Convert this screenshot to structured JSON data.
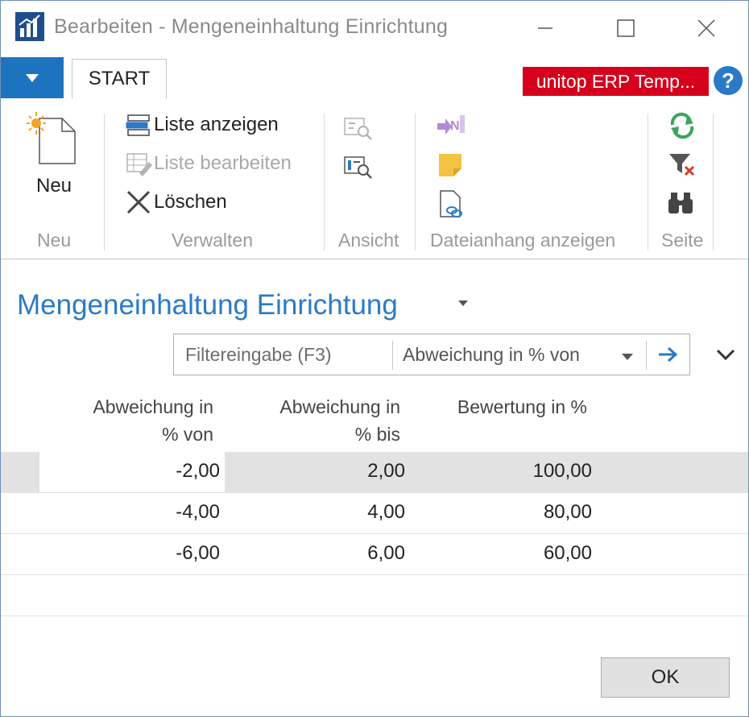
{
  "window": {
    "title": "Bearbeiten - Mengeneinhaltung Einrichtung"
  },
  "ribbon": {
    "tab_start": "START",
    "company": "unitop ERP Temp...",
    "help": "?",
    "groups": {
      "neu": {
        "label": "Neu",
        "new_button": "Neu"
      },
      "verwalten": {
        "label": "Verwalten",
        "show_list": "Liste anzeigen",
        "edit_list": "Liste bearbeiten",
        "delete": "Löschen"
      },
      "ansicht": {
        "label": "Ansicht"
      },
      "dateianhang": {
        "label": "Dateianhang anzeigen"
      },
      "seite": {
        "label": "Seite"
      }
    }
  },
  "page": {
    "title": "Mengeneinhaltung Einrichtung"
  },
  "filter": {
    "input_placeholder": "Filtereingabe (F3)",
    "field": "Abweichung in % von"
  },
  "table": {
    "headers": [
      {
        "line1": "Abweichung in",
        "line2": "% von"
      },
      {
        "line1": "Abweichung in",
        "line2": "% bis"
      },
      {
        "line1": "Bewertung in %",
        "line2": ""
      }
    ],
    "rows": [
      {
        "from": "-2,00",
        "to": "2,00",
        "rating": "100,00"
      },
      {
        "from": "-4,00",
        "to": "4,00",
        "rating": "80,00"
      },
      {
        "from": "-6,00",
        "to": "6,00",
        "rating": "60,00"
      }
    ]
  },
  "footer": {
    "ok": "OK"
  },
  "colors": {
    "accent": "#2a7ac9",
    "menu": "#1e73be",
    "company_bg": "#d6001c"
  }
}
